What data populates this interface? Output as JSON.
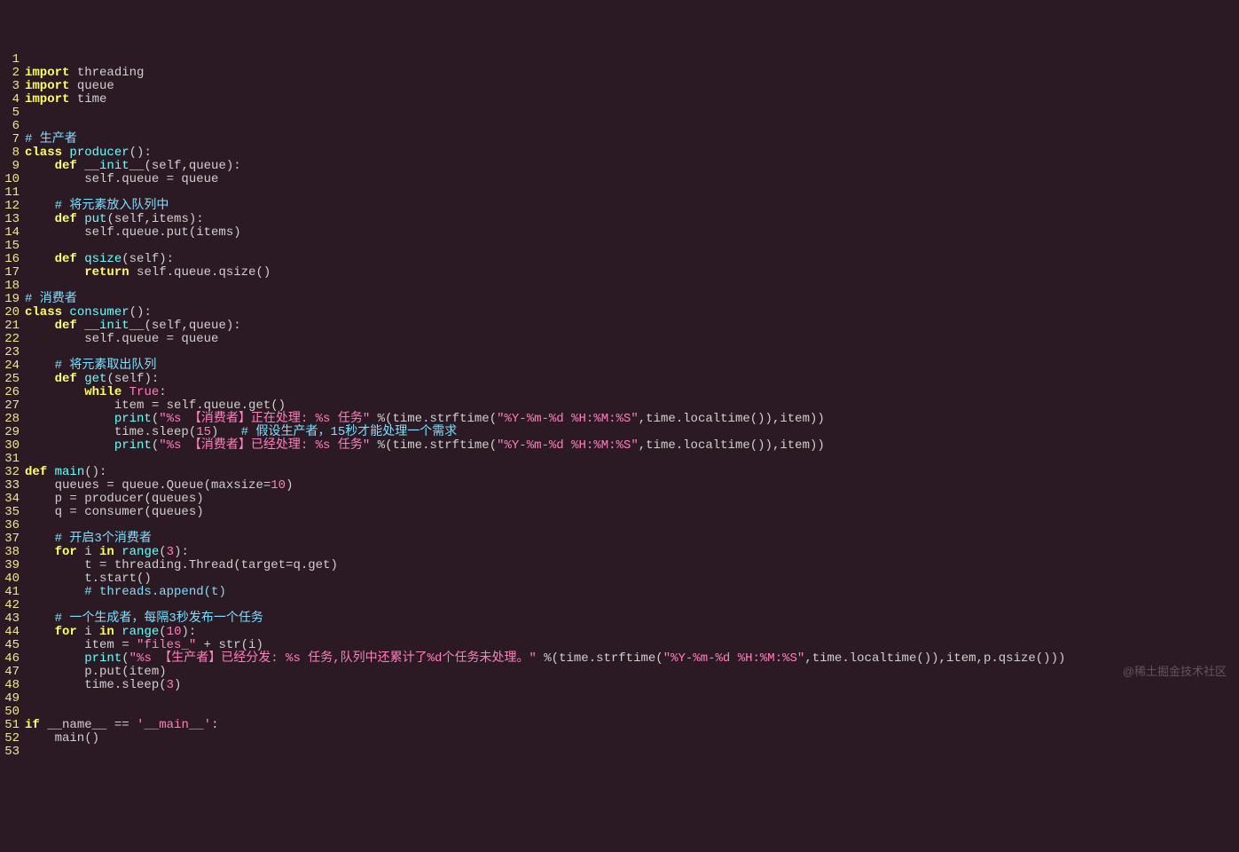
{
  "watermark": "@稀土掘金技术社区",
  "lines": [
    {
      "n": 1,
      "tokens": []
    },
    {
      "n": 2,
      "tokens": [
        {
          "t": "import",
          "c": "kw"
        },
        {
          "t": " threading",
          "c": "id"
        }
      ]
    },
    {
      "n": 3,
      "tokens": [
        {
          "t": "import",
          "c": "kw"
        },
        {
          "t": " queue",
          "c": "id"
        }
      ]
    },
    {
      "n": 4,
      "tokens": [
        {
          "t": "import",
          "c": "kw"
        },
        {
          "t": " time",
          "c": "id"
        }
      ]
    },
    {
      "n": 5,
      "tokens": []
    },
    {
      "n": 6,
      "tokens": []
    },
    {
      "n": 7,
      "tokens": [
        {
          "t": "# 生产者",
          "c": "cmt"
        }
      ]
    },
    {
      "n": 8,
      "tokens": [
        {
          "t": "class ",
          "c": "kw"
        },
        {
          "t": "producer",
          "c": "fn"
        },
        {
          "t": "():",
          "c": "id"
        }
      ]
    },
    {
      "n": 9,
      "tokens": [
        {
          "t": "    ",
          "c": "id"
        },
        {
          "t": "def ",
          "c": "kw"
        },
        {
          "t": "__init__",
          "c": "fn"
        },
        {
          "t": "(self,queue):",
          "c": "id"
        }
      ]
    },
    {
      "n": 10,
      "tokens": [
        {
          "t": "        self.queue = queue",
          "c": "id"
        }
      ]
    },
    {
      "n": 11,
      "tokens": []
    },
    {
      "n": 12,
      "tokens": [
        {
          "t": "    ",
          "c": "id"
        },
        {
          "t": "# 将元素放入队列中",
          "c": "cmt"
        }
      ]
    },
    {
      "n": 13,
      "tokens": [
        {
          "t": "    ",
          "c": "id"
        },
        {
          "t": "def ",
          "c": "kw"
        },
        {
          "t": "put",
          "c": "fn"
        },
        {
          "t": "(self,items):",
          "c": "id"
        }
      ]
    },
    {
      "n": 14,
      "tokens": [
        {
          "t": "        self.queue.put(items)",
          "c": "id"
        }
      ]
    },
    {
      "n": 15,
      "tokens": []
    },
    {
      "n": 16,
      "tokens": [
        {
          "t": "    ",
          "c": "id"
        },
        {
          "t": "def ",
          "c": "kw"
        },
        {
          "t": "qsize",
          "c": "fn"
        },
        {
          "t": "(self):",
          "c": "id"
        }
      ]
    },
    {
      "n": 17,
      "tokens": [
        {
          "t": "        ",
          "c": "id"
        },
        {
          "t": "return",
          "c": "kw"
        },
        {
          "t": " self.queue.qsize()",
          "c": "id"
        }
      ]
    },
    {
      "n": 18,
      "tokens": []
    },
    {
      "n": 19,
      "tokens": [
        {
          "t": "# 消费者",
          "c": "cmt"
        }
      ]
    },
    {
      "n": 20,
      "tokens": [
        {
          "t": "class ",
          "c": "kw"
        },
        {
          "t": "consumer",
          "c": "fn"
        },
        {
          "t": "():",
          "c": "id"
        }
      ]
    },
    {
      "n": 21,
      "tokens": [
        {
          "t": "    ",
          "c": "id"
        },
        {
          "t": "def ",
          "c": "kw"
        },
        {
          "t": "__init__",
          "c": "fn"
        },
        {
          "t": "(self,queue):",
          "c": "id"
        }
      ]
    },
    {
      "n": 22,
      "tokens": [
        {
          "t": "        self.queue = queue",
          "c": "id"
        }
      ]
    },
    {
      "n": 23,
      "tokens": []
    },
    {
      "n": 24,
      "tokens": [
        {
          "t": "    ",
          "c": "id"
        },
        {
          "t": "# 将元素取出队列",
          "c": "cmt"
        }
      ]
    },
    {
      "n": 25,
      "tokens": [
        {
          "t": "    ",
          "c": "id"
        },
        {
          "t": "def ",
          "c": "kw"
        },
        {
          "t": "get",
          "c": "fn"
        },
        {
          "t": "(self):",
          "c": "id"
        }
      ]
    },
    {
      "n": 26,
      "tokens": [
        {
          "t": "        ",
          "c": "id"
        },
        {
          "t": "while ",
          "c": "kw"
        },
        {
          "t": "True",
          "c": "bool"
        },
        {
          "t": ":",
          "c": "id"
        }
      ]
    },
    {
      "n": 27,
      "tokens": [
        {
          "t": "            item = self.queue.get()",
          "c": "id"
        }
      ]
    },
    {
      "n": 28,
      "tokens": [
        {
          "t": "            ",
          "c": "id"
        },
        {
          "t": "print",
          "c": "fn"
        },
        {
          "t": "(",
          "c": "id"
        },
        {
          "t": "\"%s 【消费者】正在处理: %s 任务\"",
          "c": "str"
        },
        {
          "t": " %(time.strftime(",
          "c": "id"
        },
        {
          "t": "\"%Y-%m-%d %H:%M:%S\"",
          "c": "str"
        },
        {
          "t": ",time.localtime()),item))",
          "c": "id"
        }
      ]
    },
    {
      "n": 29,
      "tokens": [
        {
          "t": "            time.sleep(",
          "c": "id"
        },
        {
          "t": "15",
          "c": "num"
        },
        {
          "t": ")   ",
          "c": "id"
        },
        {
          "t": "# 假设生产者，15秒才能处理一个需求",
          "c": "cmt"
        }
      ]
    },
    {
      "n": 30,
      "tokens": [
        {
          "t": "            ",
          "c": "id"
        },
        {
          "t": "print",
          "c": "fn"
        },
        {
          "t": "(",
          "c": "id"
        },
        {
          "t": "\"%s 【消费者】已经处理: %s 任务\"",
          "c": "str"
        },
        {
          "t": " %(time.strftime(",
          "c": "id"
        },
        {
          "t": "\"%Y-%m-%d %H:%M:%S\"",
          "c": "str"
        },
        {
          "t": ",time.localtime()),item))",
          "c": "id"
        }
      ]
    },
    {
      "n": 31,
      "tokens": []
    },
    {
      "n": 32,
      "tokens": [
        {
          "t": "def ",
          "c": "kw"
        },
        {
          "t": "main",
          "c": "fn"
        },
        {
          "t": "():",
          "c": "id"
        }
      ]
    },
    {
      "n": 33,
      "tokens": [
        {
          "t": "    queues = queue.Queue(maxsize=",
          "c": "id"
        },
        {
          "t": "10",
          "c": "num"
        },
        {
          "t": ")",
          "c": "id"
        }
      ]
    },
    {
      "n": 34,
      "tokens": [
        {
          "t": "    p = producer(queues)",
          "c": "id"
        }
      ]
    },
    {
      "n": 35,
      "tokens": [
        {
          "t": "    q = consumer(queues)",
          "c": "id"
        }
      ]
    },
    {
      "n": 36,
      "tokens": []
    },
    {
      "n": 37,
      "tokens": [
        {
          "t": "    ",
          "c": "id"
        },
        {
          "t": "# 开启3个消费者",
          "c": "cmt"
        }
      ]
    },
    {
      "n": 38,
      "tokens": [
        {
          "t": "    ",
          "c": "id"
        },
        {
          "t": "for ",
          "c": "kw"
        },
        {
          "t": "i ",
          "c": "id"
        },
        {
          "t": "in ",
          "c": "kw"
        },
        {
          "t": "range",
          "c": "fn"
        },
        {
          "t": "(",
          "c": "id"
        },
        {
          "t": "3",
          "c": "num"
        },
        {
          "t": "):",
          "c": "id"
        }
      ]
    },
    {
      "n": 39,
      "tokens": [
        {
          "t": "        t = threading.Thread(target=q.get)",
          "c": "id"
        }
      ]
    },
    {
      "n": 40,
      "tokens": [
        {
          "t": "        t.start()",
          "c": "id"
        }
      ]
    },
    {
      "n": 41,
      "tokens": [
        {
          "t": "        ",
          "c": "id"
        },
        {
          "t": "# threads.append(t)",
          "c": "cmt"
        }
      ]
    },
    {
      "n": 42,
      "tokens": []
    },
    {
      "n": 43,
      "tokens": [
        {
          "t": "    ",
          "c": "id"
        },
        {
          "t": "# 一个生成者，每隔3秒发布一个任务",
          "c": "cmt"
        }
      ]
    },
    {
      "n": 44,
      "tokens": [
        {
          "t": "    ",
          "c": "id"
        },
        {
          "t": "for ",
          "c": "kw"
        },
        {
          "t": "i ",
          "c": "id"
        },
        {
          "t": "in ",
          "c": "kw"
        },
        {
          "t": "range",
          "c": "fn"
        },
        {
          "t": "(",
          "c": "id"
        },
        {
          "t": "10",
          "c": "num"
        },
        {
          "t": "):",
          "c": "id"
        }
      ]
    },
    {
      "n": 45,
      "tokens": [
        {
          "t": "        item = ",
          "c": "id"
        },
        {
          "t": "\"files_\"",
          "c": "str"
        },
        {
          "t": " + str(i)",
          "c": "id"
        }
      ]
    },
    {
      "n": 46,
      "tokens": [
        {
          "t": "        ",
          "c": "id"
        },
        {
          "t": "print",
          "c": "fn"
        },
        {
          "t": "(",
          "c": "id"
        },
        {
          "t": "\"%s 【生产者】已经分发: %s 任务,队列中还累计了%d个任务未处理。\"",
          "c": "str"
        },
        {
          "t": " %(time.strftime(",
          "c": "id"
        },
        {
          "t": "\"%Y-%m-%d %H:%M:%S\"",
          "c": "str"
        },
        {
          "t": ",time.localtime()),item,p.qsize()))",
          "c": "id"
        }
      ]
    },
    {
      "n": 47,
      "tokens": [
        {
          "t": "        p.put(item)",
          "c": "id"
        }
      ]
    },
    {
      "n": 48,
      "tokens": [
        {
          "t": "        time.sleep(",
          "c": "id"
        },
        {
          "t": "3",
          "c": "num"
        },
        {
          "t": ")",
          "c": "id"
        }
      ]
    },
    {
      "n": 49,
      "tokens": []
    },
    {
      "n": 50,
      "tokens": []
    },
    {
      "n": 51,
      "tokens": [
        {
          "t": "if ",
          "c": "kw"
        },
        {
          "t": "__name__ == ",
          "c": "id"
        },
        {
          "t": "'__main__'",
          "c": "str"
        },
        {
          "t": ":",
          "c": "id"
        }
      ]
    },
    {
      "n": 52,
      "tokens": [
        {
          "t": "    main()",
          "c": "id"
        }
      ]
    },
    {
      "n": 53,
      "tokens": []
    }
  ]
}
